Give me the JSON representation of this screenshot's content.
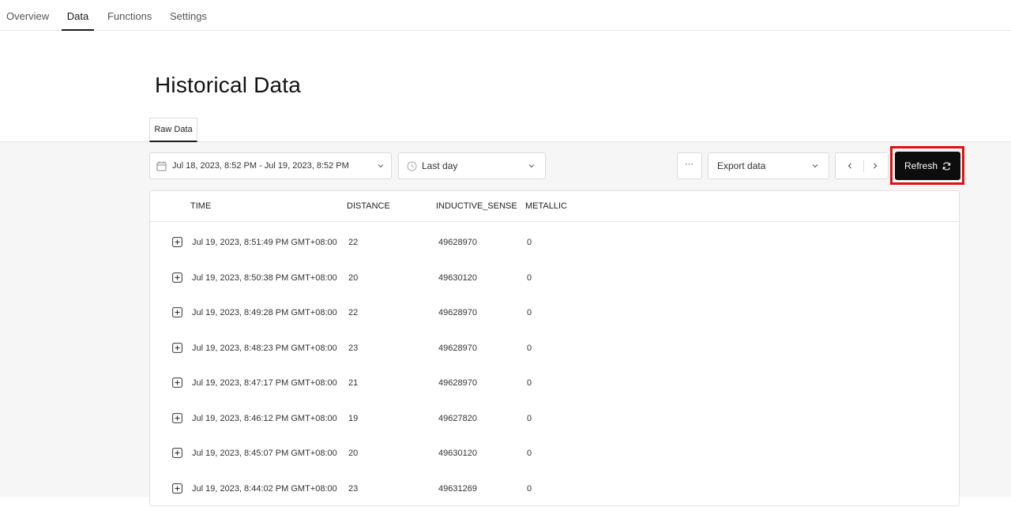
{
  "nav": {
    "tabs": [
      {
        "label": "Overview"
      },
      {
        "label": "Data",
        "active": true
      },
      {
        "label": "Functions"
      },
      {
        "label": "Settings"
      }
    ]
  },
  "page": {
    "title": "Historical Data",
    "subtab": "Raw Data"
  },
  "toolbar": {
    "date_range": "Jul 18, 2023, 8:52 PM - Jul 19, 2023, 8:52 PM",
    "date_range_icon": "calendar-icon",
    "period": "Last day",
    "period_icon": "clock-icon",
    "more_label": "···",
    "export_label": "Export data",
    "refresh_label": "Refresh",
    "refresh_icon": "refresh-icon"
  },
  "table": {
    "columns": [
      "TIME",
      "DISTANCE",
      "INDUCTIVE_SENSE",
      "METALLIC"
    ],
    "rows": [
      {
        "time": "Jul 19, 2023, 8:51:49 PM GMT+08:00",
        "distance": "22",
        "inductive_sense": "49628970",
        "metallic": "0"
      },
      {
        "time": "Jul 19, 2023, 8:50:38 PM GMT+08:00",
        "distance": "20",
        "inductive_sense": "49630120",
        "metallic": "0"
      },
      {
        "time": "Jul 19, 2023, 8:49:28 PM GMT+08:00",
        "distance": "22",
        "inductive_sense": "49628970",
        "metallic": "0"
      },
      {
        "time": "Jul 19, 2023, 8:48:23 PM GMT+08:00",
        "distance": "23",
        "inductive_sense": "49628970",
        "metallic": "0"
      },
      {
        "time": "Jul 19, 2023, 8:47:17 PM GMT+08:00",
        "distance": "21",
        "inductive_sense": "49628970",
        "metallic": "0"
      },
      {
        "time": "Jul 19, 2023, 8:46:12 PM GMT+08:00",
        "distance": "19",
        "inductive_sense": "49627820",
        "metallic": "0"
      },
      {
        "time": "Jul 19, 2023, 8:45:07 PM GMT+08:00",
        "distance": "20",
        "inductive_sense": "49630120",
        "metallic": "0"
      },
      {
        "time": "Jul 19, 2023, 8:44:02 PM GMT+08:00",
        "distance": "23",
        "inductive_sense": "49631269",
        "metallic": "0"
      }
    ]
  },
  "colors": {
    "highlight": "#e01010",
    "refresh_bg": "#0d0d0d"
  }
}
